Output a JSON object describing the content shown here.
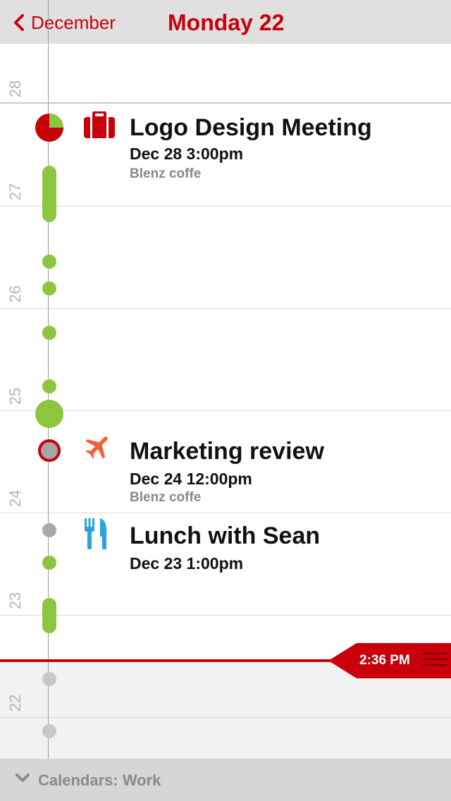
{
  "header": {
    "back_label": "December",
    "title": "Monday 22"
  },
  "days": [
    "28",
    "27",
    "26",
    "25",
    "24",
    "23",
    "22"
  ],
  "events": [
    {
      "title": "Logo Design Meeting",
      "date": "Dec 28 3:00pm",
      "location": "Blenz coffe",
      "icon": "briefcase-icon",
      "color": "#c8000a"
    },
    {
      "title": "Marketing review",
      "date": "Dec 24 12:00pm",
      "location": "Blenz coffe",
      "icon": "airplane-icon",
      "color": "#f0603a"
    },
    {
      "title": "Lunch with Sean",
      "date": "Dec 23 1:00pm",
      "icon": "fork-knife-icon",
      "color": "#2ba4dd"
    }
  ],
  "now": {
    "label": "2:36 PM",
    "color": "#c8000a"
  },
  "footer": {
    "label": "Calendars: Work"
  },
  "colors": {
    "accent": "#c8000a",
    "busy_green": "#8cc63f",
    "past_gray": "#c8c8c8"
  }
}
